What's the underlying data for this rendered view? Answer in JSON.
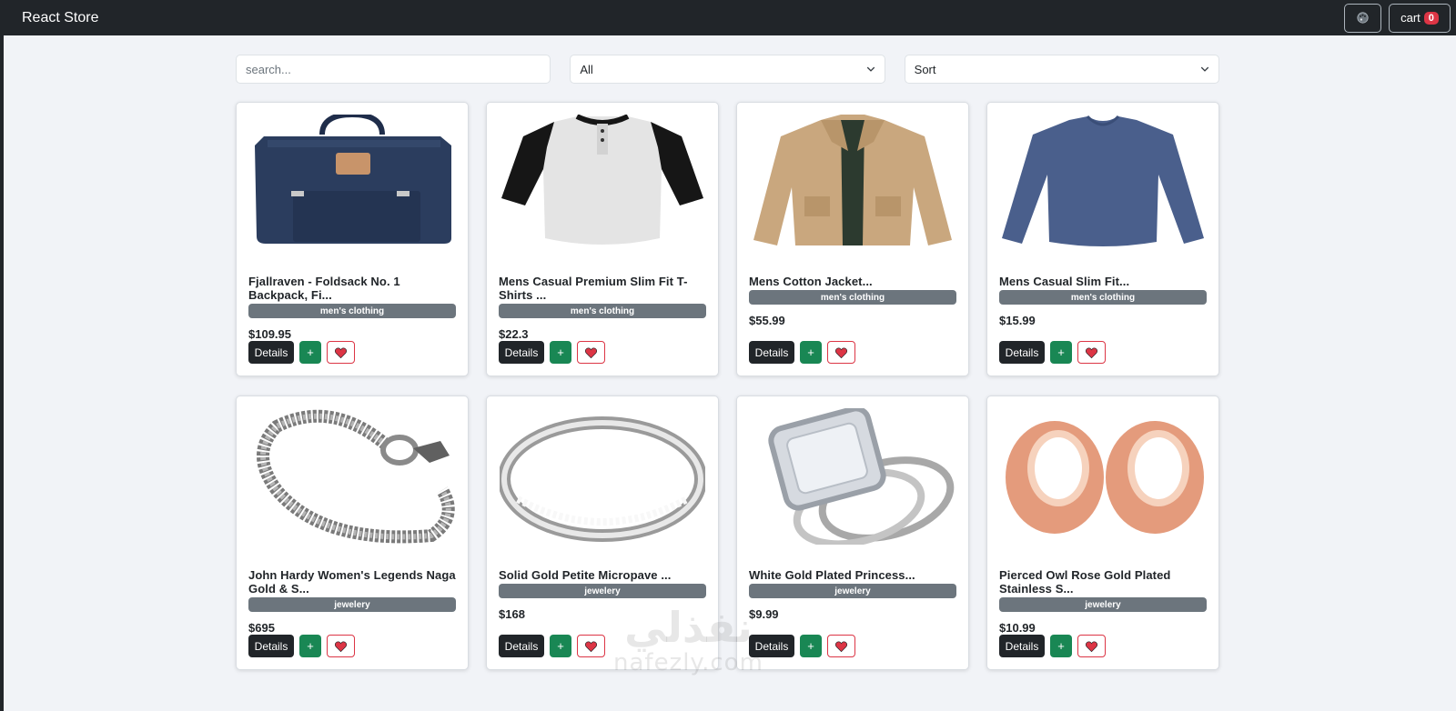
{
  "navbar": {
    "brand": "React Store",
    "theme_icon": "palette-icon",
    "cart_label": "cart",
    "cart_count": "0"
  },
  "filters": {
    "search_placeholder": "search...",
    "category_value": "All",
    "sort_value": "Sort"
  },
  "buttons": {
    "details": "Details",
    "add": "+"
  },
  "products": [
    {
      "title": "Fjallraven - Foldsack No. 1 Backpack, Fi...",
      "category": "men's clothing",
      "price": "$109.95",
      "icon": "backpack-image"
    },
    {
      "title": "Mens Casual Premium Slim Fit T-Shirts ...",
      "category": "men's clothing",
      "price": "$22.3",
      "icon": "tshirt-image"
    },
    {
      "title": "Mens Cotton Jacket...",
      "category": "men's clothing",
      "price": "$55.99",
      "icon": "jacket-image"
    },
    {
      "title": "Mens Casual Slim Fit...",
      "category": "men's clothing",
      "price": "$15.99",
      "icon": "longsleeve-image"
    },
    {
      "title": "John Hardy Women's Legends Naga Gold & S...",
      "category": "jewelery",
      "price": "$695",
      "icon": "bracelet-image"
    },
    {
      "title": "Solid Gold Petite Micropave ...",
      "category": "jewelery",
      "price": "$168",
      "icon": "ring-image"
    },
    {
      "title": "White Gold Plated Princess...",
      "category": "jewelery",
      "price": "$9.99",
      "icon": "diamond-ring-image"
    },
    {
      "title": "Pierced Owl Rose Gold Plated Stainless S...",
      "category": "jewelery",
      "price": "$10.99",
      "icon": "ear-plugs-image"
    }
  ],
  "watermark": {
    "arabic": "نفذلي",
    "latin": "nafezly.com"
  },
  "colors": {
    "navbar": "#212529",
    "badge": "#6c757d",
    "add": "#198754",
    "fav": "#dc3545"
  }
}
